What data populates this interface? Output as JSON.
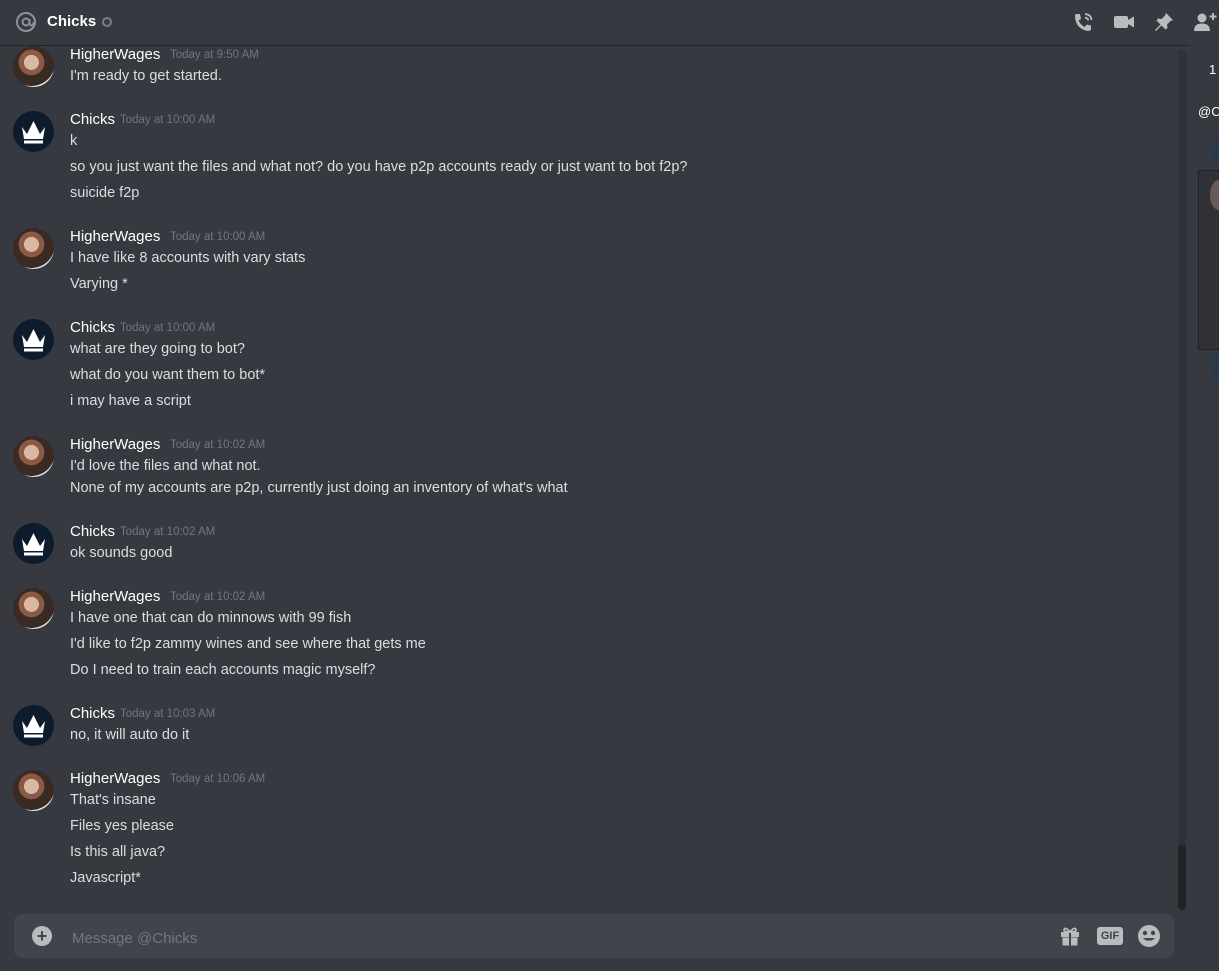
{
  "header": {
    "channel_name": "Chicks",
    "icons": [
      "at-icon",
      "phone-call-icon",
      "video-call-icon",
      "pin-icon",
      "add-friend-icon"
    ]
  },
  "messages": [
    {
      "author": "HigherWages",
      "timestamp": "Today at 9:50 AM",
      "avatar": "higherwages-avatar",
      "lines": [
        "I'm ready to get started."
      ]
    },
    {
      "author": "Chicks",
      "timestamp": "Today at 10:00 AM",
      "avatar": "chicks-crown-avatar",
      "lines": [
        "k",
        "so you just want the files and what not? do you have p2p accounts ready or just want to bot f2p?",
        "suicide f2p"
      ]
    },
    {
      "author": "HigherWages",
      "timestamp": "Today at 10:00 AM",
      "avatar": "higherwages-avatar",
      "lines": [
        "I have like 8 accounts with vary stats",
        "Varying *"
      ]
    },
    {
      "author": "Chicks",
      "timestamp": "Today at 10:00 AM",
      "avatar": "chicks-crown-avatar",
      "lines": [
        "what are they going to bot?",
        "what do you want them to bot*",
        "i may have a script"
      ]
    },
    {
      "author": "HigherWages",
      "timestamp": "Today at 10:02 AM",
      "avatar": "higherwages-avatar",
      "lines": [
        "I'd love the files and what not.",
        "None of my accounts are p2p, currently just doing an inventory of what's what"
      ]
    },
    {
      "author": "Chicks",
      "timestamp": "Today at 10:02 AM",
      "avatar": "chicks-crown-avatar",
      "lines": [
        "ok sounds good"
      ]
    },
    {
      "author": "HigherWages",
      "timestamp": "Today at 10:02 AM",
      "avatar": "higherwages-avatar",
      "lines": [
        "I have one that can do minnows with 99 fish",
        "I'd like to f2p zammy wines and see where that gets me",
        "Do I need to train each accounts magic myself?"
      ]
    },
    {
      "author": "Chicks",
      "timestamp": "Today at 10:03 AM",
      "avatar": "chicks-crown-avatar",
      "lines": [
        "no, it will auto do it"
      ]
    },
    {
      "author": "HigherWages",
      "timestamp": "Today at 10:06 AM",
      "avatar": "higherwages-avatar",
      "lines": [
        "That's insane",
        "Files yes please",
        "Is this all java?",
        "Javascript*"
      ]
    }
  ],
  "side_panel": {
    "count": "1",
    "mention": "@C"
  },
  "composer": {
    "placeholder": "Message @Chicks",
    "gif_label": "GIF"
  },
  "colors": {
    "background": "#36393f",
    "composer": "#40444b",
    "timestamp": "#72767d",
    "text": "#dcddde"
  }
}
